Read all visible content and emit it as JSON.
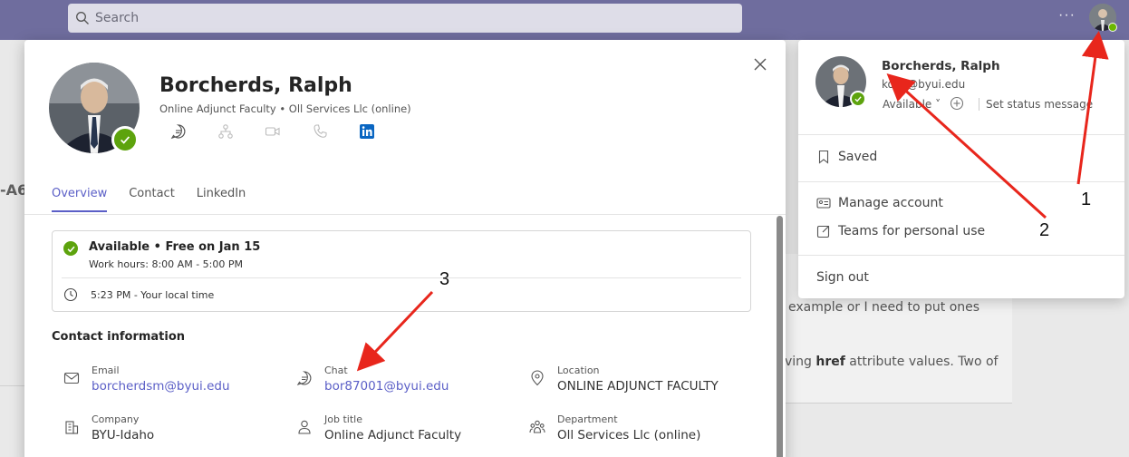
{
  "topbar": {
    "search_placeholder": "Search",
    "more_label": "···"
  },
  "background": {
    "left_fragment": "-A6",
    "line1": "example or I need to put ones",
    "line2_prefix": "ving ",
    "line2_bold": "href",
    "line2_suffix": " attribute values. Two of"
  },
  "profile": {
    "name": "Borcherds, Ralph",
    "subtitle": "Online Adjunct Faculty • Oll Services Llc (online)",
    "actions": [
      "chat",
      "org-chart",
      "video-call",
      "audio-call",
      "linkedin"
    ],
    "tabs": [
      {
        "label": "Overview",
        "active": true
      },
      {
        "label": "Contact",
        "active": false
      },
      {
        "label": "LinkedIn",
        "active": false
      }
    ],
    "availability": {
      "status": "Available • Free on Jan 15",
      "work_hours": "Work hours: 8:00 AM - 5:00 PM",
      "local_time": "5:23 PM - Your local time"
    },
    "contact_heading": "Contact information",
    "contact": {
      "email": {
        "label": "Email",
        "value": "borcherdsm@byui.edu"
      },
      "chat": {
        "label": "Chat",
        "value": "bor87001@byui.edu"
      },
      "location": {
        "label": "Location",
        "value": "ONLINE ADJUNCT FACULTY"
      },
      "company": {
        "label": "Company",
        "value": "BYU-Idaho"
      },
      "job_title": {
        "label": "Job title",
        "value": "Online Adjunct Faculty"
      },
      "department": {
        "label": "Department",
        "value": "Oll Services Llc (online)"
      }
    }
  },
  "account_menu": {
    "name": "Borcherds, Ralph",
    "email": "kolib@byui.edu",
    "available": "Available ˅",
    "add_status": "˅",
    "set_status": "Set status message",
    "saved": "Saved",
    "manage_account": "Manage account",
    "teams_personal": "Teams for personal use",
    "sign_out": "Sign out"
  },
  "annotations": {
    "labels": [
      "1",
      "2",
      "3"
    ],
    "arrow_color": "#e8261c"
  },
  "colors": {
    "accent": "#5b5fc7",
    "titlebar": "#6f6d9e",
    "available_green": "#5da30d"
  }
}
